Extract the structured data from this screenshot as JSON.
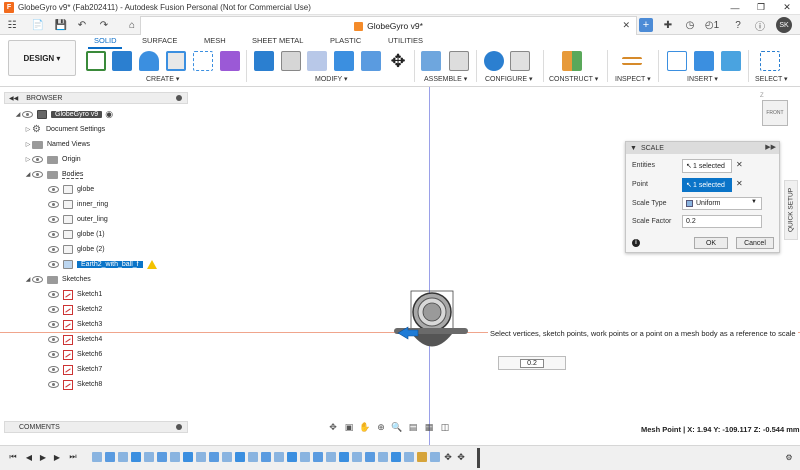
{
  "window": {
    "title": "GlobeGyro v9* (Fab202411) - Autodesk Fusion Personal (Not for Commercial Use)",
    "app_icon_letter": "F"
  },
  "tab": {
    "label": "GlobeGyro v9*",
    "notification_count": "1",
    "user_initials": "SK"
  },
  "toolbar": {
    "workspace": "DESIGN",
    "tabs": [
      "SOLID",
      "SURFACE",
      "MESH",
      "SHEET METAL",
      "PLASTIC",
      "UTILITIES"
    ],
    "groups": [
      "CREATE",
      "MODIFY",
      "ASSEMBLE",
      "CONFIGURE",
      "CONSTRUCT",
      "INSPECT",
      "INSERT",
      "SELECT"
    ]
  },
  "browser": {
    "title": "BROWSER",
    "root": "GlobeGyro v9",
    "items": [
      {
        "label": "Document Settings"
      },
      {
        "label": "Named Views"
      },
      {
        "label": "Origin"
      },
      {
        "label": "Bodies"
      }
    ],
    "bodies": [
      "globe",
      "inner_ring",
      "outer_ling",
      "globe (1)",
      "globe (2)",
      "Earth2_with_ball_f"
    ],
    "sketches_label": "Sketches",
    "sketches": [
      "Sketch1",
      "Sketch2",
      "Sketch3",
      "Sketch4",
      "Sketch6",
      "Sketch7",
      "Sketch8"
    ]
  },
  "viewcube": {
    "face": "FRONT",
    "axis": "Z"
  },
  "scale_dialog": {
    "title": "SCALE",
    "entities_label": "Entities",
    "entities_value": "1 selected",
    "point_label": "Point",
    "point_value": "1 selected",
    "scale_type_label": "Scale Type",
    "scale_type_value": "Uniform",
    "scale_factor_label": "Scale Factor",
    "scale_factor_value": "0.2",
    "ok": "OK",
    "cancel": "Cancel"
  },
  "quick_setup": "QUICK SETUP",
  "hint": "Select vertices, sketch points, work points or a point on a mesh body as a reference to scale",
  "canvas_input": "0.2",
  "comments": "COMMENTS",
  "status": "Mesh Point | X: 1.94 Y: -109.117 Z: -0.544 mm"
}
